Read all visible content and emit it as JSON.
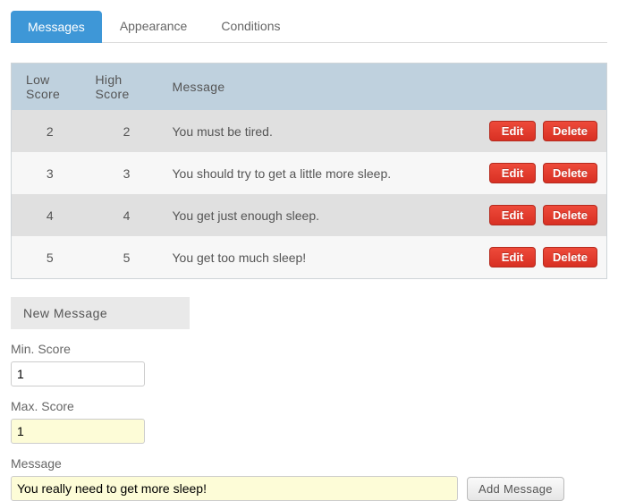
{
  "tabs": {
    "messages": "Messages",
    "appearance": "Appearance",
    "conditions": "Conditions"
  },
  "table": {
    "headers": {
      "low": "Low Score",
      "high": "High Score",
      "message": "Message"
    },
    "rows": [
      {
        "low": "2",
        "high": "2",
        "message": "You must be tired."
      },
      {
        "low": "3",
        "high": "3",
        "message": "You should try to get a little more sleep."
      },
      {
        "low": "4",
        "high": "4",
        "message": "You get just enough sleep."
      },
      {
        "low": "5",
        "high": "5",
        "message": "You get too much sleep!"
      }
    ],
    "edit_label": "Edit",
    "delete_label": "Delete"
  },
  "form": {
    "heading": "New Message",
    "min_label": "Min. Score",
    "min_value": "1",
    "max_label": "Max. Score",
    "max_value": "1",
    "message_label": "Message",
    "message_value": "You really need to get more sleep!",
    "add_button": "Add Message"
  }
}
